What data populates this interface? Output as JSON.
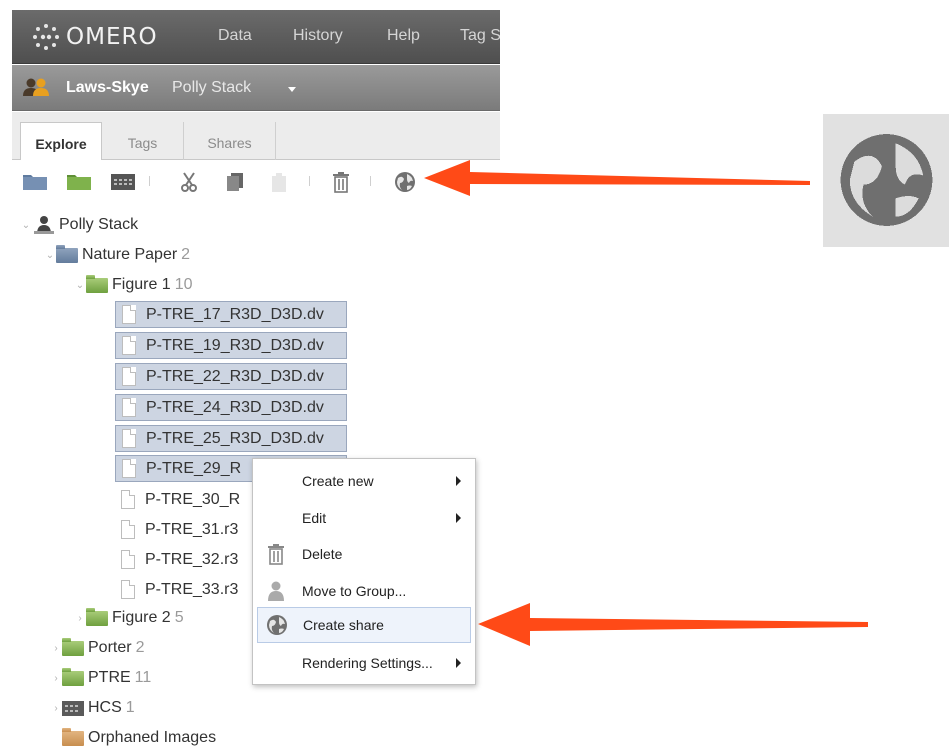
{
  "app": {
    "logo_text": "OMERO"
  },
  "nav": {
    "items": [
      "Data",
      "History",
      "Help",
      "Tag S"
    ]
  },
  "user_bar": {
    "group": "Laws-Skye",
    "user": "Polly Stack"
  },
  "tabs": [
    "Explore",
    "Tags",
    "Shares"
  ],
  "toolbar": {
    "icons": [
      "new-project-icon",
      "new-dataset-icon",
      "new-screen-icon",
      "cut-icon",
      "copy-icon",
      "paste-icon",
      "delete-icon",
      "create-share-icon"
    ]
  },
  "tree": {
    "owner": "Polly Stack",
    "project": {
      "name": "Nature Paper",
      "count": "2"
    },
    "dataset_open": {
      "name": "Figure 1",
      "count": "10"
    },
    "images": [
      "P-TRE_17_R3D_D3D.dv",
      "P-TRE_19_R3D_D3D.dv",
      "P-TRE_22_R3D_D3D.dv",
      "P-TRE_24_R3D_D3D.dv",
      "P-TRE_25_R3D_D3D.dv",
      "P-TRE_29_R",
      "P-TRE_30_R",
      "P-TRE_31.r3",
      "P-TRE_32.r3",
      "P-TRE_33.r3"
    ],
    "dataset_closed": {
      "name": "Figure 2",
      "count": "5"
    },
    "projects_other": [
      {
        "name": "Porter",
        "count": "2"
      },
      {
        "name": "PTRE",
        "count": "11"
      }
    ],
    "screen": {
      "name": "HCS",
      "count": "1"
    },
    "orphaned": "Orphaned Images"
  },
  "context_menu": {
    "items": [
      {
        "label": "Create new",
        "submenu": true
      },
      {
        "label": "Edit",
        "submenu": true
      },
      {
        "label": "Delete",
        "icon": "trash-icon"
      },
      {
        "label": "Move to Group...",
        "icon": "person-icon"
      },
      {
        "label": "Create share",
        "icon": "globe-icon",
        "highlighted": true
      },
      {
        "label": "Rendering Settings...",
        "submenu": true
      }
    ]
  },
  "colors": {
    "arrow": "#ff4a17",
    "selection": "#cdd5e2",
    "topbar": "#5a5a5a"
  }
}
